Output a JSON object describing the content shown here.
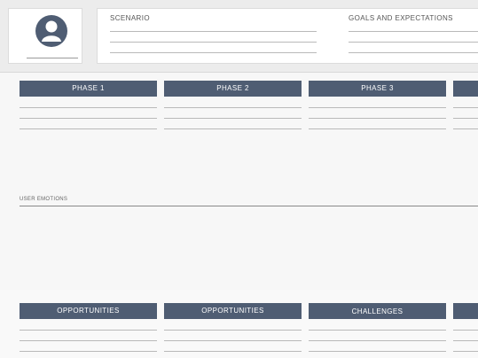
{
  "persona": {
    "avatar_icon": "user-avatar-icon"
  },
  "scenario": {
    "label": "SCENARIO"
  },
  "goals": {
    "label": "GOALS AND EXPECTATIONS"
  },
  "phases": [
    {
      "label": "PHASE 1"
    },
    {
      "label": "PHASE 2"
    },
    {
      "label": "PHASE 3"
    },
    {
      "label": ""
    }
  ],
  "emotions": {
    "label": "USER EMOTIONS"
  },
  "bottom_sections": [
    {
      "label": "OPPORTUNITIES"
    },
    {
      "label": "OPPORTUNITIES"
    },
    {
      "label": "CHALLENGES"
    },
    {
      "label": ""
    }
  ],
  "colors": {
    "header_bg": "#4f5d73",
    "header_text": "#ffffff"
  }
}
